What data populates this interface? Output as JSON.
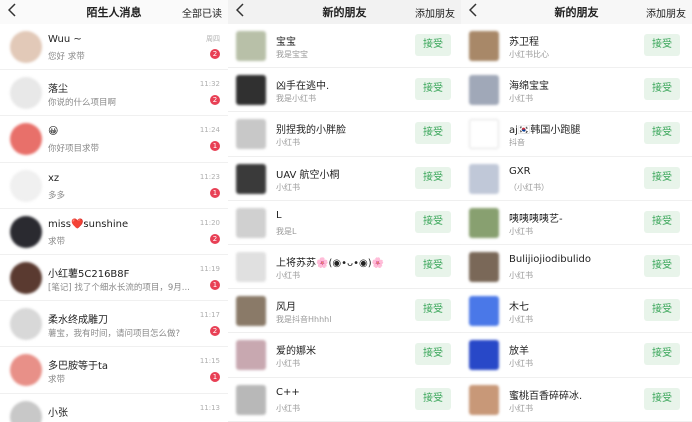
{
  "messages_panel": {
    "title": "陌生人消息",
    "mark_all_read": "全部已读",
    "items": [
      {
        "name": "Wuu ~",
        "msg": "您好 求带",
        "time": "周四",
        "badge": "2",
        "avatar_color": "#e2c9b8"
      },
      {
        "name": "落尘",
        "msg": "你说的什么项目啊",
        "time": "11:32",
        "badge": "2",
        "avatar_color": "#e8e8e8"
      },
      {
        "name": "😀",
        "msg": "你好项目求带",
        "time": "11:24",
        "badge": "1",
        "avatar_color": "#e8706a"
      },
      {
        "name": "xz",
        "msg": "多多",
        "time": "11:23",
        "badge": "1",
        "avatar_color": "#f0f0f0"
      },
      {
        "name": "miss❤️sunshine",
        "msg": "求带",
        "time": "11:20",
        "badge": "2",
        "avatar_color": "#2a2a30"
      },
      {
        "name": "小红薯5C216B8F",
        "msg": "[笔记] 找了个细水长流的项目，9月...",
        "time": "11:19",
        "badge": "1",
        "avatar_color": "#5a3a30"
      },
      {
        "name": "柔水终成雕刀",
        "msg": "薯宝，我有时间，请问项目怎么做?",
        "time": "11:17",
        "badge": "2",
        "avatar_color": "#d8d8d8"
      },
      {
        "name": "多巴胺等于ta",
        "msg": "求带",
        "time": "11:15",
        "badge": "1",
        "avatar_color": "#e89088"
      },
      {
        "name": "小张",
        "msg": "",
        "time": "11:13",
        "badge": "",
        "avatar_color": "#c8c8c8"
      }
    ]
  },
  "new_friends_panel_1": {
    "title": "新的朋友",
    "add_friend": "添加朋友",
    "accept_label": "接受",
    "items": [
      {
        "name": "宝宝",
        "source": "我是宝宝",
        "avatar_color": "#b8c0a8"
      },
      {
        "name": "凶手在逃中.",
        "source": "我是小红书",
        "avatar_color": "#303030"
      },
      {
        "name": "别捏我的小胖脸",
        "source": "小红书",
        "avatar_color": "#c8c8c8"
      },
      {
        "name": "UAV 航空小桐",
        "source": "小红书",
        "avatar_color": "#3a3a3a"
      },
      {
        "name": "L",
        "source": "我是L",
        "avatar_color": "#d0d0d0"
      },
      {
        "name": "上将苏苏🌸(◉•ᴗ•◉)🌸",
        "source": "小红书",
        "avatar_color": "#e0e0e0"
      },
      {
        "name": "风月",
        "source": "我是抖音Hhhhl",
        "avatar_color": "#8a7a68"
      },
      {
        "name": "爱的娜米",
        "source": "小红书",
        "avatar_color": "#c8a8b0"
      },
      {
        "name": "C++",
        "source": "小红书",
        "avatar_color": "#b8b8b8"
      }
    ]
  },
  "new_friends_panel_2": {
    "title": "新的朋友",
    "add_friend": "添加朋友",
    "accept_label": "接受",
    "items": [
      {
        "name": "苏卫程",
        "source": "小红书比心",
        "avatar_color": "#a88868"
      },
      {
        "name": "海绵宝宝",
        "source": "小红书",
        "avatar_color": "#a0a8b8"
      },
      {
        "name": "aj🇰🇷韩国小跑腿",
        "source": "抖音",
        "avatar_color": "#ffffff"
      },
      {
        "name": "GXR",
        "source": "（小红书）",
        "avatar_color": "#c0c8d8"
      },
      {
        "name": "咦咦咦咦艺-",
        "source": "小红书",
        "avatar_color": "#88a070"
      },
      {
        "name": "Bulijiojiodibulido",
        "source": "小红书",
        "avatar_color": "#7a6858"
      },
      {
        "name": "木七",
        "source": "小红书",
        "avatar_color": "#4a78e8"
      },
      {
        "name": "放羊",
        "source": "小红书",
        "avatar_color": "#2848c8"
      },
      {
        "name": "蜜桃百香碎碎冰.",
        "source": "小红书",
        "avatar_color": "#c89878"
      }
    ]
  }
}
